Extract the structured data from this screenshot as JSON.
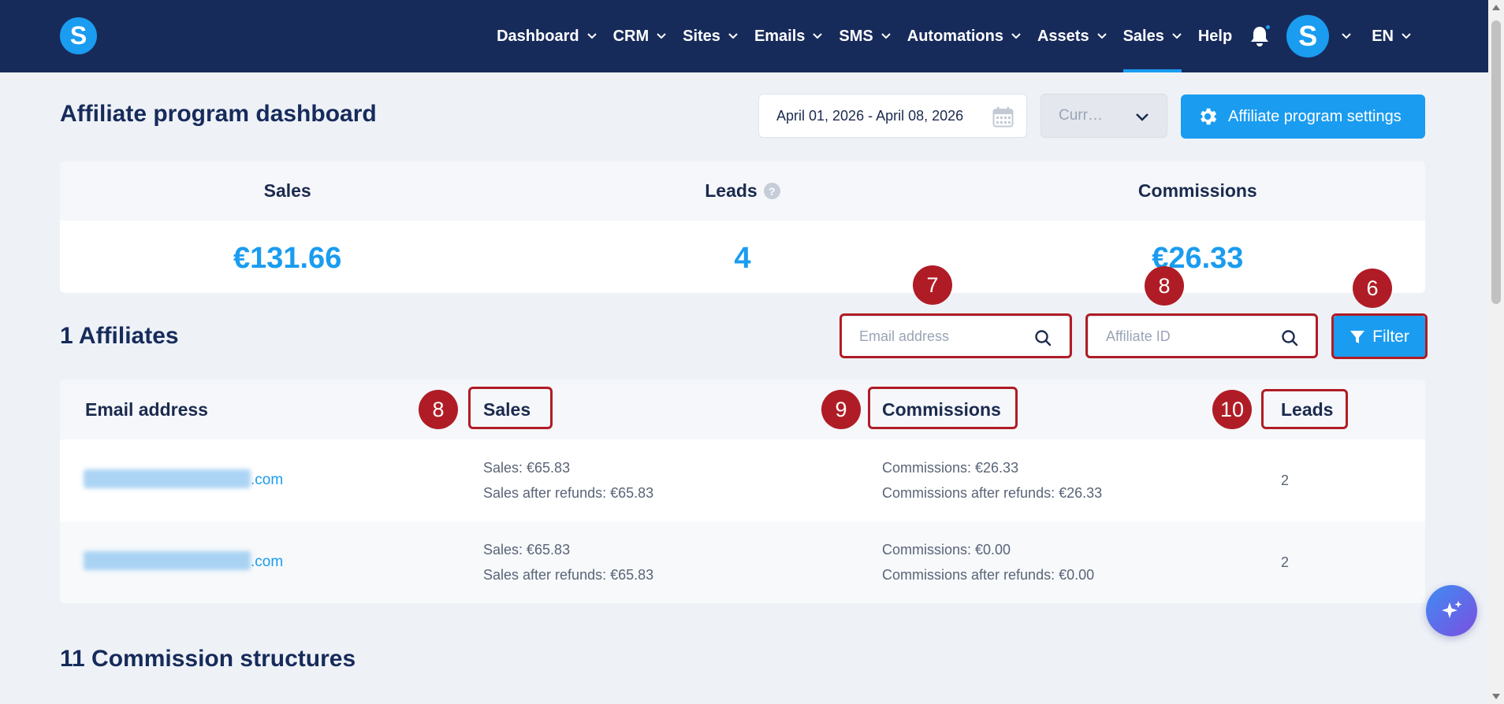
{
  "nav": {
    "logo_letter": "S",
    "items": [
      {
        "label": "Dashboard",
        "has_dropdown": true
      },
      {
        "label": "CRM",
        "has_dropdown": true
      },
      {
        "label": "Sites",
        "has_dropdown": true
      },
      {
        "label": "Emails",
        "has_dropdown": true
      },
      {
        "label": "SMS",
        "has_dropdown": true
      },
      {
        "label": "Automations",
        "has_dropdown": true
      },
      {
        "label": "Assets",
        "has_dropdown": true
      },
      {
        "label": "Sales",
        "has_dropdown": true,
        "active": true
      },
      {
        "label": "Help",
        "has_dropdown": false
      }
    ],
    "avatar_letter": "S",
    "language": "EN"
  },
  "header": {
    "title": "Affiliate program dashboard",
    "date_range": "April 01, 2026 - April 08, 2026",
    "currency_placeholder": "Curr…",
    "settings_button": "Affiliate program settings"
  },
  "stats": {
    "sales_label": "Sales",
    "sales_value": "€131.66",
    "leads_label": "Leads",
    "leads_help": "?",
    "leads_value": "4",
    "commissions_label": "Commissions",
    "commissions_value": "€26.33"
  },
  "affiliates": {
    "title": "1 Affiliates",
    "email_search_placeholder": "Email address",
    "affiliate_id_placeholder": "Affiliate ID",
    "filter_button": "Filter",
    "columns": {
      "email": "Email address",
      "sales": "Sales",
      "commissions": "Commissions",
      "leads": "Leads"
    },
    "rows": [
      {
        "email_suffix": ".com",
        "sales": "Sales: €65.83",
        "sales_after_refunds": "Sales after refunds: €65.83",
        "commissions": "Commissions: €26.33",
        "commissions_after_refunds": "Commissions after refunds: €26.33",
        "leads": "2"
      },
      {
        "email_suffix": ".com",
        "sales": "Sales: €65.83",
        "sales_after_refunds": "Sales after refunds: €65.83",
        "commissions": "Commissions: €0.00",
        "commissions_after_refunds": "Commissions after refunds: €0.00",
        "leads": "2"
      }
    ]
  },
  "commission_structures": {
    "title": "11 Commission structures"
  },
  "annotations": {
    "filter": "6",
    "email_search": "7",
    "affiliate_id_search": "8",
    "sales_column": "8",
    "commissions_column": "9",
    "leads_column": "10"
  },
  "colors": {
    "navbar": "#172b5b",
    "accent": "#1a9cf0",
    "annotation": "#b01c25",
    "background": "#eef2f7"
  }
}
